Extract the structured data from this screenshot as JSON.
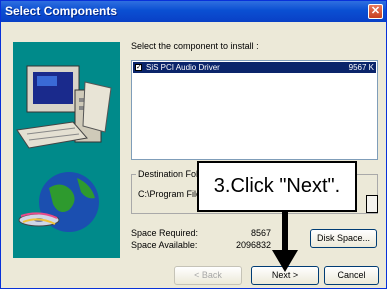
{
  "window": {
    "title": "Select Components",
    "close_icon": "close-icon"
  },
  "instruction": "Select the component to install :",
  "components": [
    {
      "label": "SiS PCI Audio Driver",
      "size": "9567 K",
      "checked": true
    }
  ],
  "destination": {
    "legend": "Destination Fold",
    "path": "C:\\Program File"
  },
  "space": {
    "required_label": "Space Required:",
    "required_value": "8567",
    "available_label": "Space Available:",
    "available_value": "2096832"
  },
  "buttons": {
    "disk_space": "Disk Space...",
    "back": "< Back",
    "next": "Next >",
    "cancel": "Cancel"
  },
  "callout": {
    "text": "3.Click \"Next\"."
  },
  "colors": {
    "titlebar": "#0a4fd2",
    "art_background": "#008a8a",
    "selection": "#0a246a"
  }
}
